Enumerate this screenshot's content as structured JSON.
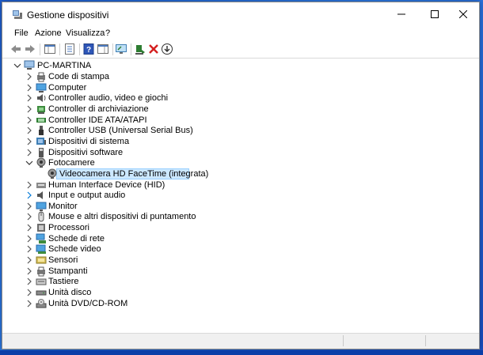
{
  "window": {
    "title": "Gestione dispositivi"
  },
  "menu": [
    "File",
    "Azione",
    "Visualizza",
    "?"
  ],
  "tree": {
    "root": "PC-MARTINA",
    "items": [
      {
        "label": "Code di stampa",
        "icon": "printer-queue-icon",
        "state": "collapsed"
      },
      {
        "label": "Computer",
        "icon": "computer-icon",
        "state": "collapsed"
      },
      {
        "label": "Controller audio, video e giochi",
        "icon": "speaker-icon",
        "state": "collapsed"
      },
      {
        "label": "Controller di archiviazione",
        "icon": "storage-controller-icon",
        "state": "collapsed"
      },
      {
        "label": "Controller IDE ATA/ATAPI",
        "icon": "ide-controller-icon",
        "state": "collapsed"
      },
      {
        "label": "Controller USB (Universal Serial Bus)",
        "icon": "usb-icon",
        "state": "collapsed"
      },
      {
        "label": "Dispositivi di sistema",
        "icon": "system-device-icon",
        "state": "collapsed"
      },
      {
        "label": "Dispositivi software",
        "icon": "software-device-icon",
        "state": "collapsed"
      },
      {
        "label": "Fotocamere",
        "icon": "camera-icon",
        "state": "expanded"
      },
      {
        "label": "Videocamera HD FaceTime (integrata)",
        "icon": "webcam-icon",
        "state": "child",
        "selected": true
      },
      {
        "label": "Human Interface Device (HID)",
        "icon": "hid-icon",
        "state": "collapsed"
      },
      {
        "label": "Input e output audio",
        "icon": "audio-io-icon",
        "state": "collapsed",
        "highlight_chevron": true
      },
      {
        "label": "Monitor",
        "icon": "monitor-icon",
        "state": "collapsed"
      },
      {
        "label": "Mouse e altri dispositivi di puntamento",
        "icon": "mouse-icon",
        "state": "collapsed"
      },
      {
        "label": "Processori",
        "icon": "processor-icon",
        "state": "collapsed"
      },
      {
        "label": "Schede di rete",
        "icon": "network-adapter-icon",
        "state": "collapsed"
      },
      {
        "label": "Schede video",
        "icon": "display-adapter-icon",
        "state": "collapsed"
      },
      {
        "label": "Sensori",
        "icon": "sensor-icon",
        "state": "collapsed"
      },
      {
        "label": "Stampanti",
        "icon": "printer-icon",
        "state": "collapsed"
      },
      {
        "label": "Tastiere",
        "icon": "keyboard-icon",
        "state": "collapsed"
      },
      {
        "label": "Unità disco",
        "icon": "disk-drive-icon",
        "state": "collapsed"
      },
      {
        "label": "Unità DVD/CD-ROM",
        "icon": "dvd-drive-icon",
        "state": "collapsed"
      }
    ]
  },
  "colors": {
    "selection": "#cce8ff",
    "selection_border": "#99d1ff",
    "accent": "#0078d7",
    "desktop": "#2d7be6"
  }
}
